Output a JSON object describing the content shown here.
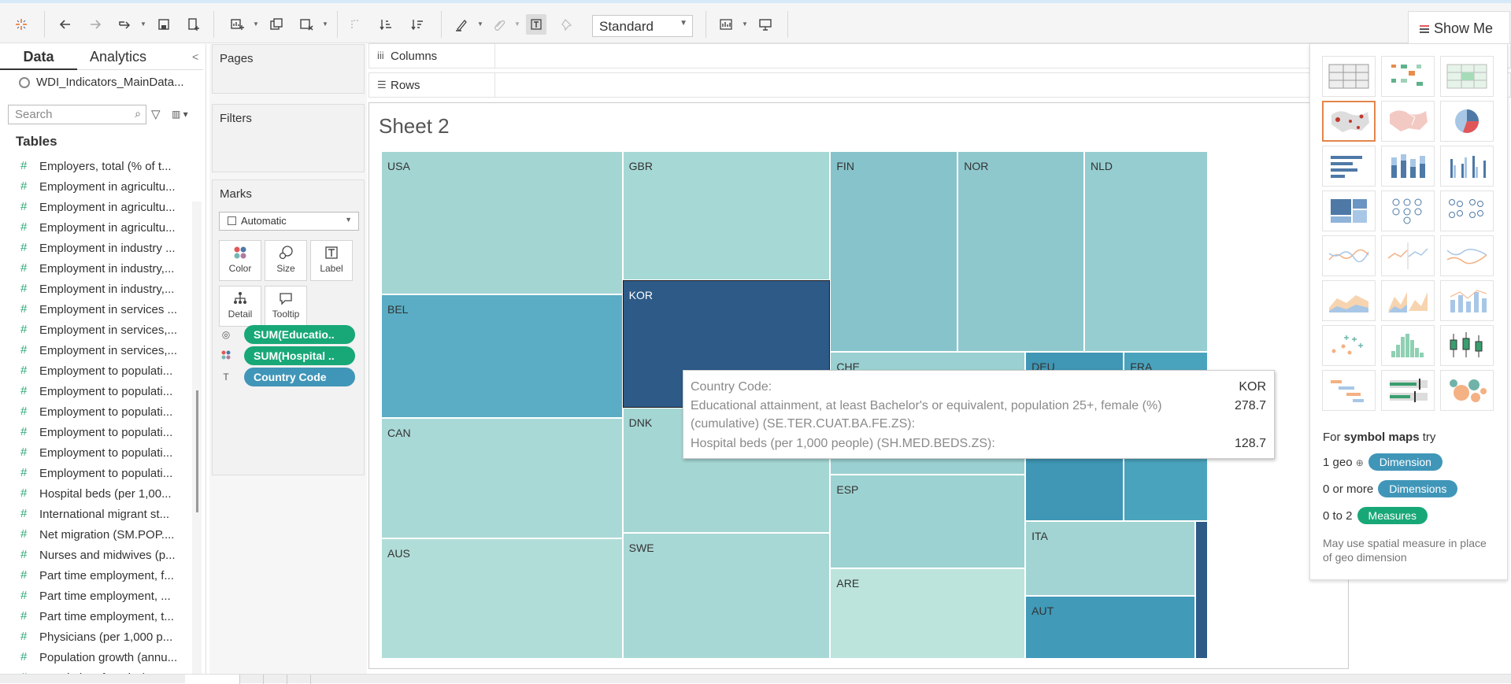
{
  "toolbar": {
    "view_mode": "Standard",
    "show_me_label": "Show Me"
  },
  "sidebar": {
    "tab_data": "Data",
    "tab_analytics": "Analytics",
    "datasource": "WDI_Indicators_MainData...",
    "search_placeholder": "Search",
    "tables_heading": "Tables",
    "fields": [
      "Employers, total (% of t...",
      "Employment in agricultu...",
      "Employment in agricultu...",
      "Employment in agricultu...",
      "Employment in industry ...",
      "Employment in industry,...",
      "Employment in industry,...",
      "Employment in services ...",
      "Employment in services,...",
      "Employment in services,...",
      "Employment to populati...",
      "Employment to populati...",
      "Employment to populati...",
      "Employment to populati...",
      "Employment to populati...",
      "Employment to populati...",
      "Hospital beds (per 1,00...",
      "International migrant st...",
      "Net migration (SM.POP....",
      "Nurses and midwives (p...",
      "Part time employment, f...",
      "Part time employment, ...",
      "Part time employment, t...",
      "Physicians (per 1,000 p...",
      "Population growth (annu...",
      "Population, female (SP...."
    ]
  },
  "cards": {
    "pages": "Pages",
    "filters": "Filters",
    "marks": "Marks",
    "mark_type": "Automatic",
    "buttons": {
      "color": "Color",
      "size": "Size",
      "label": "Label",
      "detail": "Detail",
      "tooltip": "Tooltip"
    },
    "pills": [
      "SUM(Educatio..",
      "SUM(Hospital ..",
      "Country Code"
    ]
  },
  "shelves": {
    "columns": "Columns",
    "rows": "Rows"
  },
  "sheet": {
    "title": "Sheet 2",
    "cells": [
      "USA",
      "GBR",
      "FIN",
      "NOR",
      "NLD",
      "BEL",
      "KOR",
      "CHE",
      "DEU",
      "FRA",
      "CAN",
      "DNK",
      "ESP",
      "AUS",
      "SWE",
      "ITA",
      "ARE",
      "AUT"
    ]
  },
  "tooltip": {
    "label_country": "Country Code:",
    "value_country": "KOR",
    "label_edu_1": "Educational attainment, at least Bachelor's or equivalent, population 25+, female (%)",
    "label_edu_2": "(cumulative) (SE.TER.CUAT.BA.FE.ZS):",
    "value_edu": "278.7",
    "label_beds": "Hospital beds (per 1,000 people) (SH.MED.BEDS.ZS):",
    "value_beds": "128.7"
  },
  "showme": {
    "hint_prefix": "For",
    "hint_bold": "symbol maps",
    "hint_suffix": "try",
    "req1_label": "1 geo",
    "req1_pill": "Dimension",
    "req2_label": "0 or more",
    "req2_pill": "Dimensions",
    "req3_label": "0 to 2",
    "req3_pill": "Measures",
    "note": "May use spatial measure in place of geo dimension"
  }
}
